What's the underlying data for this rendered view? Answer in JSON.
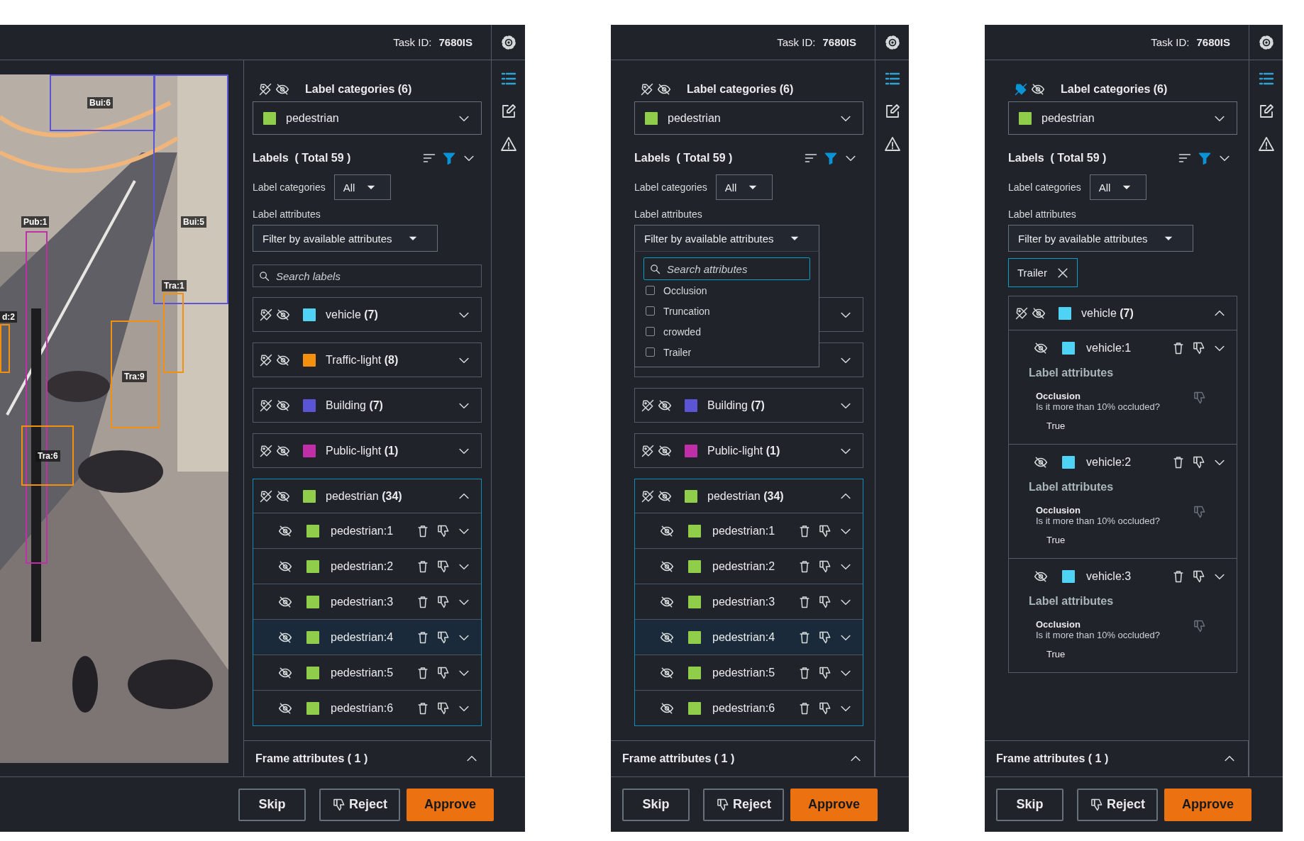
{
  "panels": [
    {
      "task_label": "Task ID:",
      "task_id": "7680IS",
      "image": {
        "kind": "picture",
        "annotations": [
          {
            "label": "Bui:6",
            "color": "#5b55d6"
          },
          {
            "label": "Bui:5",
            "color": "#5b55d6"
          },
          {
            "label": "Pub:1",
            "color": "#c02fa8"
          },
          {
            "label": "Tra:1",
            "color": "#f5900f"
          },
          {
            "label": "Tra:9",
            "color": "#f5900f"
          },
          {
            "label": "Tra:6",
            "color": "#f5900f"
          },
          {
            "label": "d:2",
            "color": "#f5900f"
          }
        ]
      },
      "categories_title": "Label categories (6)",
      "labels_hidden": false,
      "category_select": {
        "value": "pedestrian",
        "color": "#8fcd4a"
      },
      "labels_title": "Labels  ( Total 59 )",
      "category_filter": {
        "label": "Label categories",
        "value": "All"
      },
      "attribute_filter": {
        "label": "Label attributes",
        "value": "Filter by available attributes",
        "expanded": false
      },
      "search": {
        "placeholder": "Search labels"
      },
      "groups": [
        {
          "name": "vehicle **(7)**",
          "color": "#4fd3f5",
          "expanded": false,
          "selected": false
        },
        {
          "name": "Traffic-light **(8)**",
          "color": "#f5900f",
          "expanded": false,
          "selected": false
        },
        {
          "name": "Building **(7)**",
          "color": "#5b55d6",
          "expanded": false,
          "selected": false
        },
        {
          "name": "Public-light **(1)**",
          "color": "#c02fa8",
          "expanded": false,
          "selected": false
        },
        {
          "name": "pedestrian **(34)**",
          "color": "#8fcd4a",
          "expanded": true,
          "selected": true,
          "items": [
            {
              "name": "pedestrian:1",
              "color": "#8fcd4a",
              "selected": false
            },
            {
              "name": "pedestrian:2",
              "color": "#8fcd4a",
              "selected": false
            },
            {
              "name": "pedestrian:3",
              "color": "#8fcd4a",
              "selected": false
            },
            {
              "name": "pedestrian:4",
              "color": "#8fcd4a",
              "selected": true
            },
            {
              "name": "pedestrian:5",
              "color": "#8fcd4a",
              "selected": false
            },
            {
              "name": "pedestrian:6",
              "color": "#8fcd4a",
              "selected": false
            }
          ]
        }
      ],
      "frame_attributes": "Frame attributes ( 1 )",
      "buttons": [
        {
          "label": "Skip",
          "kind": "plain"
        },
        {
          "label": "Reject",
          "kind": "reject"
        },
        {
          "label": "Approve",
          "kind": "primary"
        }
      ]
    },
    {
      "task_label": "Task ID:",
      "task_id": "7680IS",
      "categories_title": "Label categories (6)",
      "labels_hidden": false,
      "category_select": {
        "value": "pedestrian",
        "color": "#8fcd4a"
      },
      "labels_title": "Labels  ( Total 59 )",
      "category_filter": {
        "label": "Label categories",
        "value": "All"
      },
      "attribute_filter": {
        "label": "Label attributes",
        "value": "Filter by available attributes",
        "expanded": true,
        "menu": {
          "placeholder": "Search attributes",
          "options": [
            {
              "label": "Occlusion",
              "checked": false
            },
            {
              "label": "Truncation",
              "checked": false
            },
            {
              "label": "crowded",
              "checked": false
            },
            {
              "label": "Trailer",
              "checked": false
            }
          ]
        }
      },
      "groups": [
        {
          "expanded": false,
          "selected": false
        },
        {
          "expanded": false,
          "selected": false
        },
        {
          "name": "Building **(7)**",
          "color": "#5b55d6",
          "expanded": false,
          "selected": false
        },
        {
          "name": "Public-light **(1)**",
          "color": "#c02fa8",
          "expanded": false,
          "selected": false
        },
        {
          "name": "pedestrian **(34)**",
          "color": "#8fcd4a",
          "expanded": true,
          "selected": true,
          "items": [
            {
              "name": "pedestrian:1",
              "color": "#8fcd4a",
              "selected": false
            },
            {
              "name": "pedestrian:2",
              "color": "#8fcd4a",
              "selected": false
            },
            {
              "name": "pedestrian:3",
              "color": "#8fcd4a",
              "selected": false
            },
            {
              "name": "pedestrian:4",
              "color": "#8fcd4a",
              "selected": true
            },
            {
              "name": "pedestrian:5",
              "color": "#8fcd4a",
              "selected": false
            },
            {
              "name": "pedestrian:6",
              "color": "#8fcd4a",
              "selected": false
            }
          ]
        }
      ],
      "frame_attributes": "Frame attributes ( 1 )",
      "buttons": [
        {
          "label": "Skip",
          "kind": "plain"
        },
        {
          "label": "Reject",
          "kind": "reject"
        },
        {
          "label": "Approve",
          "kind": "primary"
        }
      ]
    },
    {
      "task_label": "Task ID:",
      "task_id": "7680IS",
      "categories_title": "Label categories (6)",
      "labels_hidden": true,
      "category_select": {
        "value": "pedestrian",
        "color": "#8fcd4a"
      },
      "labels_title": "Labels  ( Total 59 )",
      "category_filter": {
        "label": "Label categories",
        "value": "All"
      },
      "attribute_filter": {
        "label": "Label attributes",
        "value": "Filter by available attributes",
        "expanded": false
      },
      "chips": [
        {
          "label": "Trailer"
        }
      ],
      "groups": [
        {
          "name": "vehicle **(7)**",
          "color": "#4fd3f5",
          "expanded": true,
          "selected": false,
          "items": [
            {
              "name": "vehicle:1",
              "color": "#4fd3f5",
              "selected": false,
              "attributes_title": "Label attributes",
              "attributes": [
                {
                  "name": "Occlusion",
                  "question": "Is it more than 10% occluded?",
                  "value": "True"
                }
              ]
            },
            {
              "name": "vehicle:2",
              "color": "#4fd3f5",
              "selected": false,
              "attributes_title": "Label attributes",
              "attributes": [
                {
                  "name": "Occlusion",
                  "question": "Is it more than 10% occluded?",
                  "value": "True"
                }
              ]
            },
            {
              "name": "vehicle:3",
              "color": "#4fd3f5",
              "selected": false,
              "attributes_title": "Label attributes",
              "attributes": [
                {
                  "name": "Occlusion",
                  "question": "Is it more than 10% occluded?",
                  "value": "True"
                }
              ]
            }
          ]
        }
      ],
      "frame_attributes": "Frame attributes ( 1 )",
      "buttons": [
        {
          "label": "Skip",
          "kind": "plain"
        },
        {
          "label": "Reject",
          "kind": "reject"
        },
        {
          "label": "Approve",
          "kind": "primary"
        }
      ]
    }
  ]
}
